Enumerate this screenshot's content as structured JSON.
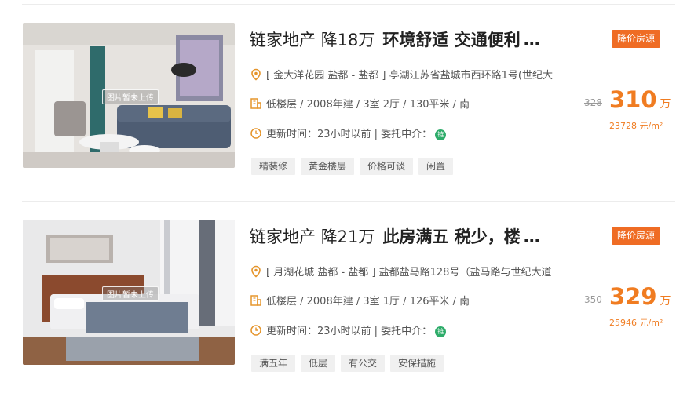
{
  "colors": {
    "accent": "#f07c21",
    "badge": "#ef6c24",
    "chain_green": "#2eac6a"
  },
  "listings": [
    {
      "agency": "链家地产",
      "price_cut": "降18万",
      "headline": "环境舒适 交通便利",
      "ellipsis": "…",
      "badge": "降价房源",
      "photo_overlay": "图片暂未上传",
      "address": "[ 金大洋花园 盐都 - 盐都 ] 亭湖江苏省盐城市西环路1号(世纪大",
      "details": "低楼层 / 2008年建 / 3室 2厅 / 130平米 / 南",
      "updated": "更新时间：23小时以前 | 委托中介：",
      "chain_icon": "链",
      "tags": [
        "精装修",
        "黄金楼层",
        "价格可谈",
        "闲置"
      ],
      "original_price": "328",
      "price": "310",
      "price_unit": "万",
      "unit_price": "23728 元/m²"
    },
    {
      "agency": "链家地产",
      "price_cut": "降21万",
      "headline": "此房满五 税少，楼",
      "ellipsis": "…",
      "badge": "降价房源",
      "photo_overlay": "图片暂未上传",
      "address": "[ 月湖花城 盐都 - 盐都 ] 盐都盐马路128号（盐马路与世纪大道",
      "details": "低楼层 / 2008年建 / 3室 1厅 / 126平米 / 南",
      "updated": "更新时间：23小时以前 | 委托中介：",
      "chain_icon": "链",
      "tags": [
        "满五年",
        "低层",
        "有公交",
        "安保措施"
      ],
      "original_price": "350",
      "price": "329",
      "price_unit": "万",
      "unit_price": "25946 元/m²"
    }
  ]
}
